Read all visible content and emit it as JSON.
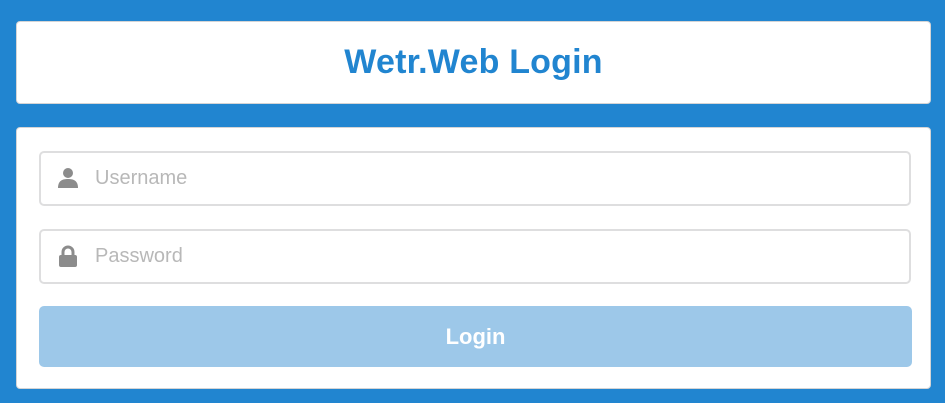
{
  "header": {
    "title": "Wetr.Web Login"
  },
  "form": {
    "username": {
      "placeholder": "Username",
      "value": "",
      "icon": "user-icon"
    },
    "password": {
      "placeholder": "Password",
      "value": "",
      "icon": "lock-icon"
    },
    "login_label": "Login"
  },
  "colors": {
    "background": "#2185d0",
    "title": "#2185d0",
    "button": "#9dc8e9",
    "icon": "#8c8c8c",
    "placeholder": "#b8b8b8"
  }
}
